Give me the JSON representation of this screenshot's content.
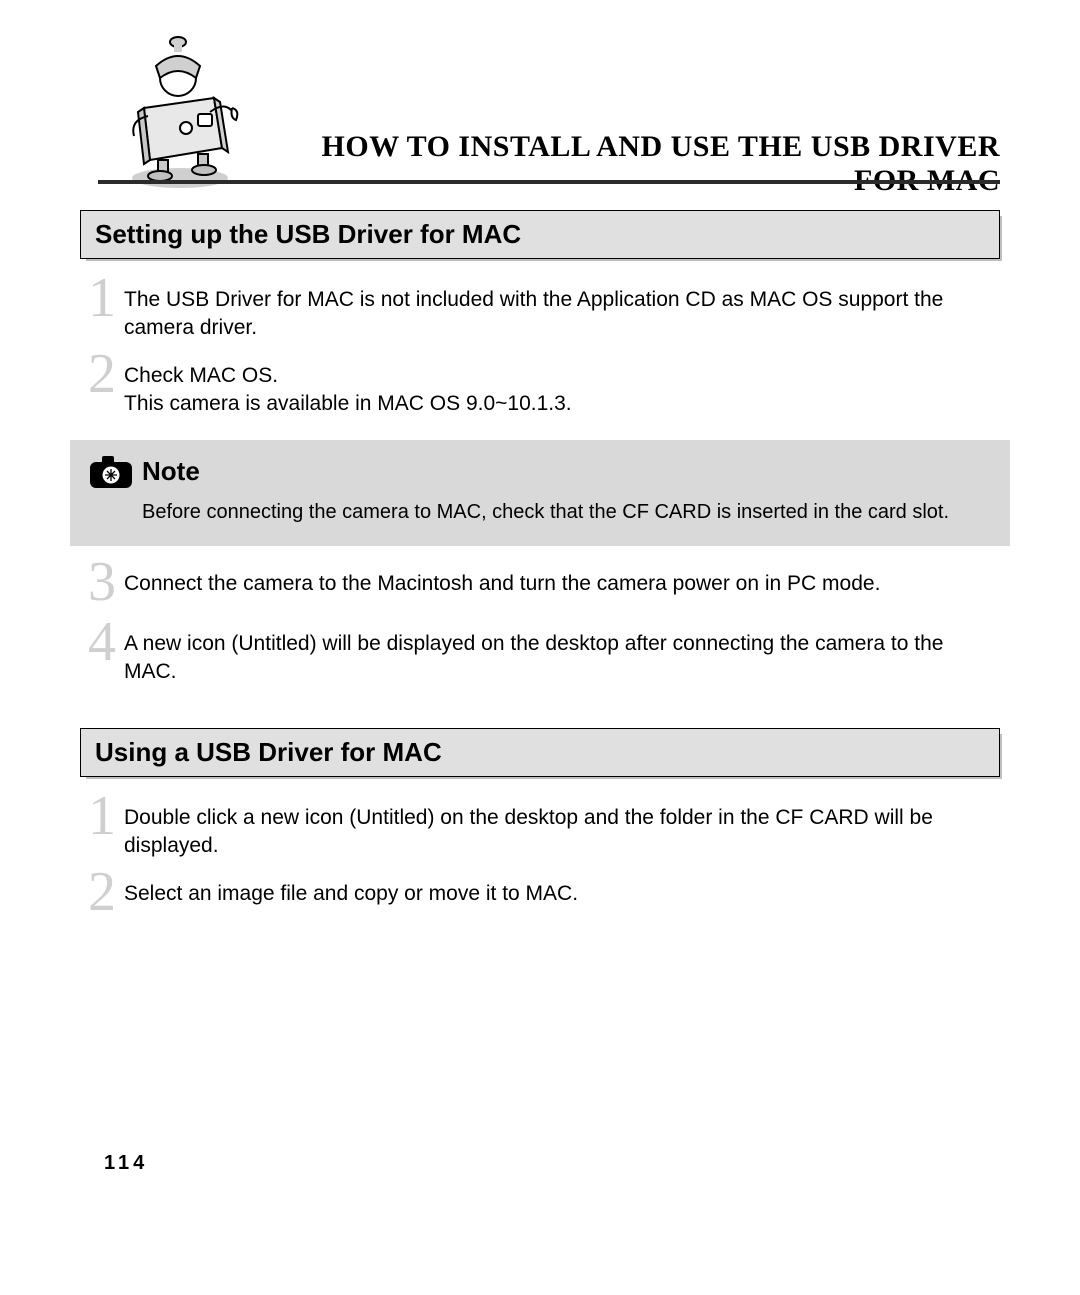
{
  "page_title": "HOW TO INSTALL AND USE THE USB DRIVER FOR MAC",
  "section_a": {
    "heading": "Setting up the USB Driver for MAC",
    "steps": [
      "The USB Driver for MAC is not included with the Application CD as MAC OS support the camera driver.",
      "Check MAC OS.\nThis camera is available in MAC OS 9.0~10.1.3."
    ]
  },
  "note": {
    "title": "Note",
    "text": "Before connecting the camera to MAC, check that the CF CARD is inserted in the card slot."
  },
  "section_a_more": {
    "steps": [
      "Connect the camera to the Macintosh and turn the camera power on in PC mode.",
      "A new icon (Untitled) will be displayed on the desktop after connecting the camera to the MAC."
    ]
  },
  "section_b": {
    "heading": "Using a USB Driver for MAC",
    "steps": [
      "Double click a new icon (Untitled) on the desktop and the folder in the CF CARD will be displayed.",
      "Select an image file and copy or move it to MAC."
    ]
  },
  "page_number": "114",
  "numerals": {
    "1": "1",
    "2": "2",
    "3": "3",
    "4": "4"
  }
}
